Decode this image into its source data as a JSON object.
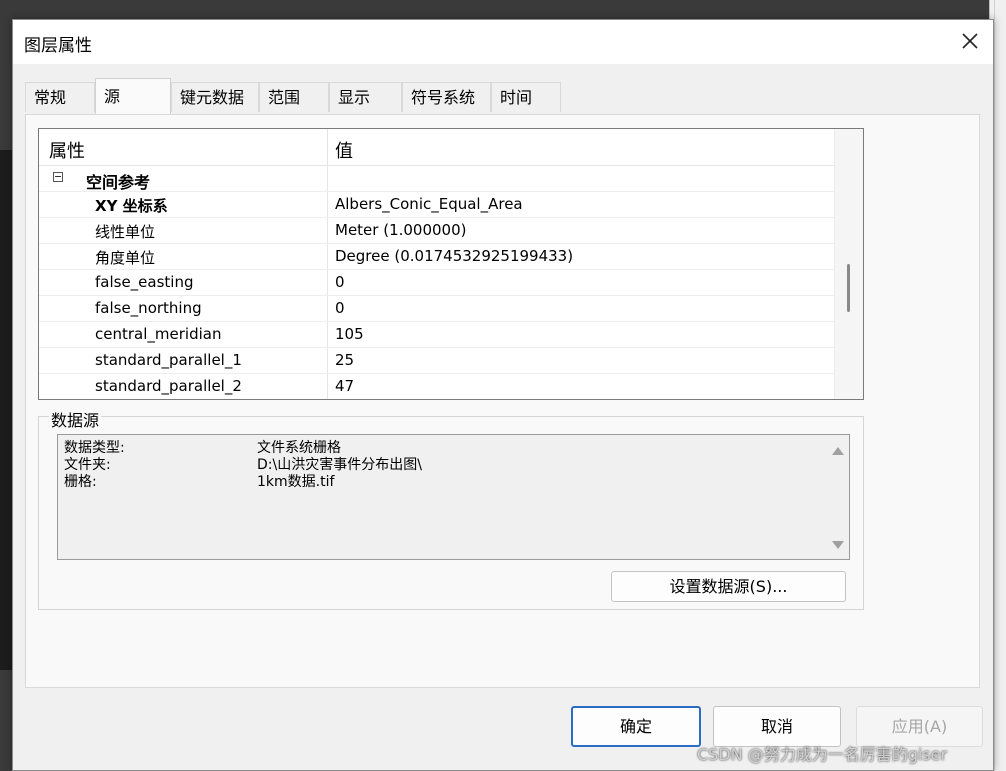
{
  "window": {
    "title": "图层属性"
  },
  "tabs": [
    {
      "label": "常规"
    },
    {
      "label": "源"
    },
    {
      "label": "键元数据"
    },
    {
      "label": "范围"
    },
    {
      "label": "显示"
    },
    {
      "label": "符号系统"
    },
    {
      "label": "时间"
    }
  ],
  "active_tab": "源",
  "grid": {
    "header": {
      "property": "属性",
      "value": "值"
    },
    "section": "空间参考",
    "rows": [
      {
        "key": "XY 坐标系",
        "value": "Albers_Conic_Equal_Area"
      },
      {
        "key": "线性单位",
        "value": "Meter (1.000000)"
      },
      {
        "key": "角度单位",
        "value": "Degree (0.0174532925199433)"
      },
      {
        "key": "false_easting",
        "value": "0"
      },
      {
        "key": "false_northing",
        "value": "0"
      },
      {
        "key": "central_meridian",
        "value": "105"
      },
      {
        "key": "standard_parallel_1",
        "value": "25"
      },
      {
        "key": "standard_parallel_2",
        "value": "47"
      }
    ]
  },
  "datasource": {
    "group_label": "数据源",
    "items": [
      {
        "key": "数据类型:",
        "value": "文件系统栅格"
      },
      {
        "key": "文件夹:",
        "value": "D:\\山洪灾害事件分布出图\\"
      },
      {
        "key": "栅格:",
        "value": "1km数据.tif"
      }
    ],
    "set_source_label": "设置数据源(S)..."
  },
  "buttons": {
    "ok": "确定",
    "cancel": "取消",
    "apply": "应用(A)"
  },
  "watermark": "CSDN @努力成为一名厉害的giser",
  "colors": {
    "accent": "#2b6cc4",
    "disabled_text": "#a6a6a6"
  }
}
